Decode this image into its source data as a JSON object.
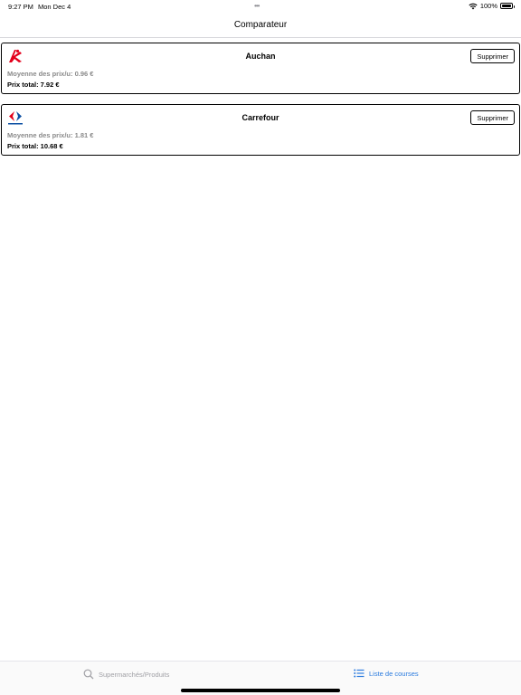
{
  "status_bar": {
    "time": "9:27 PM",
    "date": "Mon Dec 4",
    "battery": "100%"
  },
  "nav": {
    "title": "Comparateur"
  },
  "stores": [
    {
      "name": "Auchan",
      "logo": "auchan-bird-logo",
      "avg_price": "Moyenne des prix/u: 0.96 €",
      "total_price": "Prix total: 7.92 €",
      "delete_label": "Supprimer"
    },
    {
      "name": "Carrefour",
      "logo": "carrefour-logo",
      "avg_price": "Moyenne des prix/u: 1.81 €",
      "total_price": "Prix total: 10.68 €",
      "delete_label": "Supprimer"
    }
  ],
  "tabs": [
    {
      "label": "Supermarchés/Produits",
      "icon": "search-icon",
      "active": false
    },
    {
      "label": "Liste de courses",
      "icon": "list-icon",
      "active": true
    }
  ],
  "colors": {
    "accent": "#2a7bde",
    "auchan_red": "#e3001b",
    "carrefour_blue": "#0a4ea2",
    "carrefour_red": "#e2001a",
    "muted_text": "#8a8a8a"
  }
}
